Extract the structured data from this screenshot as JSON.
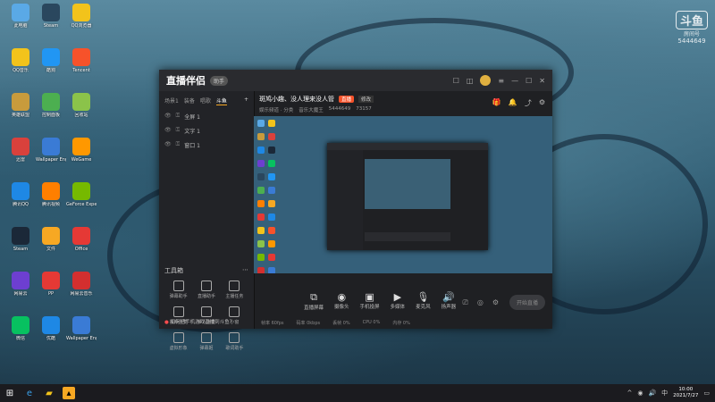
{
  "desktop": {
    "icons": [
      {
        "label": "此电脑",
        "color": "#5aa9e6"
      },
      {
        "label": "QQ音乐",
        "color": "#f2c31b"
      },
      {
        "label": "英雄联盟",
        "color": "#c89b3c"
      },
      {
        "label": "迅雷",
        "color": "#d9413c"
      },
      {
        "label": "腾讯QQ",
        "color": "#1e88e5"
      },
      {
        "label": "Steam",
        "color": "#1b2838"
      },
      {
        "label": "网易云",
        "color": "#6d3fd1"
      },
      {
        "label": "微信",
        "color": "#07c160"
      },
      {
        "label": "Steam",
        "color": "#2a475e"
      },
      {
        "label": "酷狗",
        "color": "#2196f3"
      },
      {
        "label": "控制面板",
        "color": "#4caf50"
      },
      {
        "label": "Wallpaper Engine",
        "color": "#3a7bd5"
      },
      {
        "label": "腾讯视频",
        "color": "#ff7f00"
      },
      {
        "label": "文件",
        "color": "#f7a823"
      },
      {
        "label": "PP",
        "color": "#e53935"
      },
      {
        "label": "优酷",
        "color": "#1e88e5"
      },
      {
        "label": "QQ浏览器",
        "color": "#f2c31b"
      },
      {
        "label": "Tencent",
        "color": "#f7522a"
      },
      {
        "label": "回收站",
        "color": "#8bc34a"
      },
      {
        "label": "WeGame",
        "color": "#ff9800"
      },
      {
        "label": "GeForce Experience",
        "color": "#76b900"
      },
      {
        "label": "Office",
        "color": "#e53935"
      },
      {
        "label": "网易云音乐",
        "color": "#d32f2f"
      },
      {
        "label": "Wallpaper Engine",
        "color": "#3a7bd5"
      }
    ]
  },
  "watermark": {
    "logo": "斗鱼",
    "sub": "房间号",
    "room": "5444649"
  },
  "app": {
    "title_logo": "直播伴侣",
    "badge": "助手",
    "scene_tabs": [
      "场景1",
      "装备",
      "唱歌",
      "斗鱼"
    ],
    "layers": [
      "全屏 1",
      "文字 1",
      "窗口 1"
    ],
    "toolbox_title": "工具箱",
    "tools": [
      "弹幕助手",
      "直播助手",
      "主播任务",
      "视频连麦",
      "多人连麦",
      "小窗",
      "虚拟形象",
      "弹幕姬",
      "歌词助手"
    ],
    "notice": "如何把手机游戏直播到斗鱼？",
    "room": {
      "title": "斑鸠小趣、没人理来没人管",
      "tag": "直播",
      "tag2": "修改",
      "category": "娱乐频道 · 分类",
      "host": "音乐大魔王",
      "room_id": "5444649",
      "fans": "73157"
    },
    "controls": [
      {
        "icon": "⧉",
        "label": "直播屏幕"
      },
      {
        "icon": "◉",
        "label": "摄像头"
      },
      {
        "icon": "▣",
        "label": "手机投屏"
      },
      {
        "icon": "▶",
        "label": "多媒体"
      },
      {
        "icon": "🎙",
        "label": "麦克风"
      },
      {
        "icon": "🔊",
        "label": "扬声器"
      }
    ],
    "go_live": "开始直播",
    "status": [
      "帧率 60fps",
      "码率 0kbps",
      "丢帧 0%",
      "CPU 0%",
      "内存 0%"
    ]
  },
  "taskbar": {
    "time": "10:00",
    "date": "2021/7/27"
  }
}
